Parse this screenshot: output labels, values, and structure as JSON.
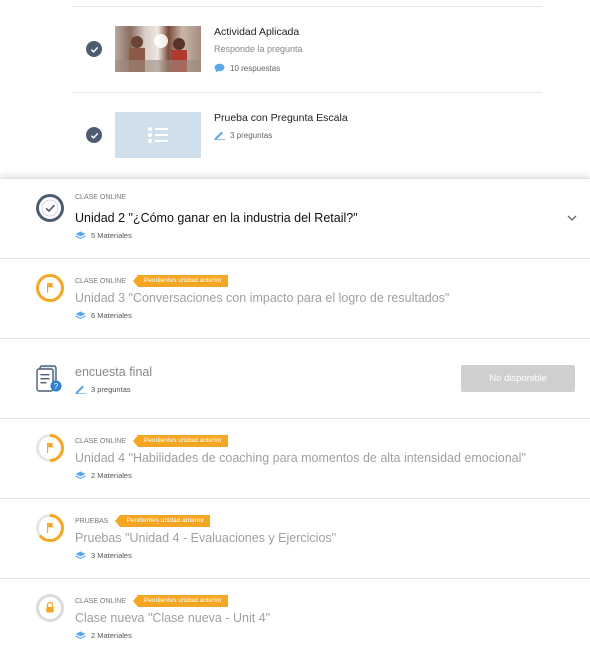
{
  "materials": [
    {
      "title": "Actividad Aplicada",
      "subtitle": "Responde la pregunta",
      "meta": "10 respuestas",
      "meta_icon": "comment-icon",
      "thumb": "photo"
    },
    {
      "title": "Prueba con Pregunta Escala",
      "subtitle": "",
      "meta": "3 preguntas",
      "meta_icon": "pencil-icon",
      "thumb": "list-icon"
    }
  ],
  "units": [
    {
      "eyebrow": "CLASE ONLINE",
      "badge": "",
      "title": "Unidad 2 \"¿Cómo ganar en la industria del Retail?\"",
      "meta": "5 Materiales",
      "status": "completed"
    },
    {
      "eyebrow": "CLASE ONLINE",
      "badge": "Pendientes unidad anterior",
      "title": "Unidad 3 \"Conversaciones con impacto para el logro de resultados\"",
      "meta": "6 Materiales",
      "status": "pending"
    },
    {
      "eyebrow": "",
      "badge": "",
      "title": "encuesta final",
      "meta": "3 preguntas",
      "status": "survey",
      "button": "No disponible"
    },
    {
      "eyebrow": "CLASE ONLINE",
      "badge": "Pendientes unidad anterior",
      "title": "Unidad 4 \"Habilidades de coaching para momentos de alta intensidad emocional\"",
      "meta": "2 Materiales",
      "status": "pending"
    },
    {
      "eyebrow": "PRUEBAS",
      "badge": "Pendientes unidad anterior",
      "title": "Pruebas \"Unidad 4 - Evaluaciones y Ejercicios\"",
      "meta": "3 Materiales",
      "status": "pending"
    },
    {
      "eyebrow": "CLASE ONLINE",
      "badge": "Pendientes unidad anterior",
      "title": "Clase nueva \"Clase nueva - Unit 4\"",
      "meta": "2 Materiales",
      "status": "locked"
    }
  ],
  "colors": {
    "accent_orange": "#f5a623",
    "dark_check": "#4d5d70",
    "survey_blue": "#2f7fd1"
  }
}
